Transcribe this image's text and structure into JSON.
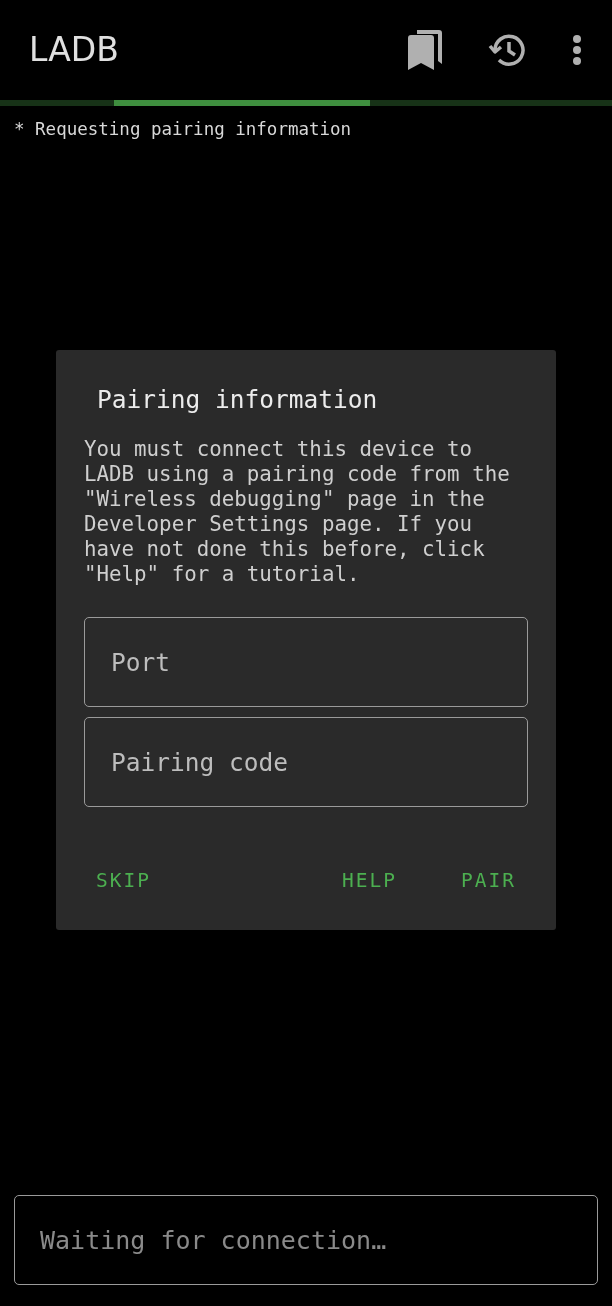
{
  "app_bar": {
    "title": "LADB"
  },
  "progress": {
    "indeterminate": true
  },
  "log": [
    "* Requesting pairing information"
  ],
  "dialog": {
    "title": "Pairing information",
    "message": "You must connect this device to LADB using a pairing code from the \"Wireless debugging\" page in the Developer Settings page. If you have not done this before, click \"Help\" for a tutorial.",
    "fields": [
      {
        "placeholder": "Port"
      },
      {
        "placeholder": "Pairing code"
      }
    ],
    "buttons": [
      {
        "label": "SKIP"
      },
      {
        "label": "HELP"
      },
      {
        "label": "PAIR"
      }
    ]
  },
  "command_field": {
    "placeholder": "Waiting for connection…"
  }
}
